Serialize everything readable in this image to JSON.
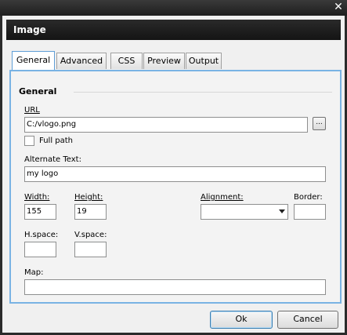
{
  "window": {
    "close_glyph": "✕"
  },
  "dialog": {
    "title": "Image"
  },
  "tabs": [
    {
      "label": "General"
    },
    {
      "label": "Advanced"
    },
    {
      "label": "CSS"
    },
    {
      "label": "Preview"
    },
    {
      "label": "Output"
    }
  ],
  "general": {
    "section_title": "General",
    "url_label": "URL",
    "url_value": "C:/vlogo.png",
    "browse_label": "...",
    "full_path_label": "Full path",
    "full_path_checked": false,
    "alt_label": "Alternate Text:",
    "alt_value": "my logo",
    "width_label": "Width:",
    "width_value": "155",
    "height_label": "Height:",
    "height_value": "19",
    "alignment_label": "Alignment:",
    "alignment_value": "",
    "border_label": "Border:",
    "border_value": "",
    "hspace_label": "H.space:",
    "hspace_value": "",
    "vspace_label": "V.space:",
    "vspace_value": "",
    "map_label": "Map:",
    "map_value": ""
  },
  "buttons": {
    "ok": "Ok",
    "cancel": "Cancel"
  }
}
